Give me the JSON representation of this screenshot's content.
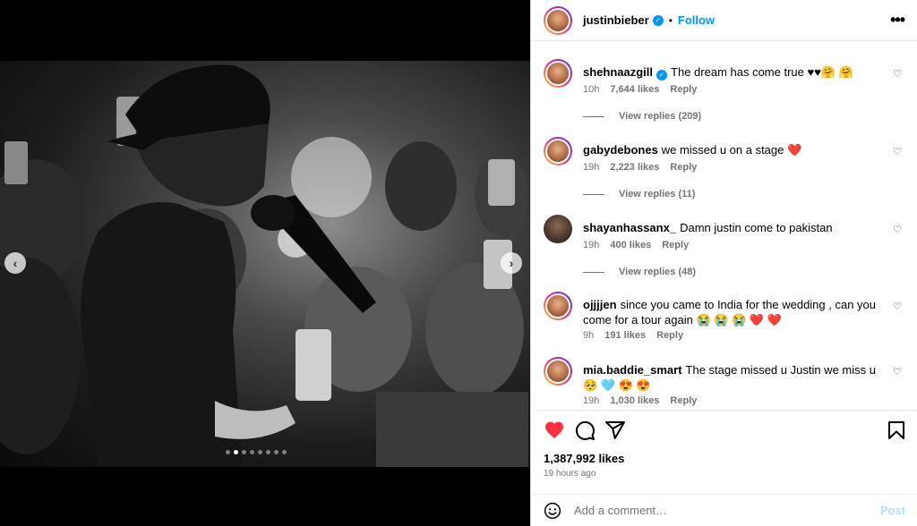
{
  "post": {
    "author": "justinbieber",
    "follow_label": "Follow",
    "separator": "•",
    "more_label": "•••",
    "likes": "1,387,992 likes",
    "time_ago": "19 hours ago"
  },
  "comments": [
    {
      "user": "shehnaazgill",
      "verified": true,
      "text": "The dream has come true ♥♥🤗 🤗",
      "time": "10h",
      "likes": "7,644 likes",
      "reply": "Reply",
      "view_replies": "View replies (209)"
    },
    {
      "user": "gabydebones",
      "verified": false,
      "text": "we missed u on a stage ❤️",
      "time": "19h",
      "likes": "2,223 likes",
      "reply": "Reply",
      "view_replies": "View replies (11)"
    },
    {
      "user": "shayanhassanx_",
      "verified": false,
      "text": "Damn justin come to pakistan",
      "time": "19h",
      "likes": "400 likes",
      "reply": "Reply",
      "view_replies": "View replies (48)"
    },
    {
      "user": "ojjjjen",
      "verified": false,
      "text": "since you came to India for the wedding , can you come for a tour again 😭 😭 😭 ❤️ ❤️",
      "time": "9h",
      "likes": "191 likes",
      "reply": "Reply"
    },
    {
      "user": "mia.baddie_smart",
      "verified": false,
      "text": "The stage missed u Justin we miss u 🥺 🩵 😍 😍",
      "time": "19h",
      "likes": "1,030 likes",
      "reply": "Reply"
    }
  ],
  "add_comment": {
    "placeholder": "Add a comment…",
    "post_label": "Post"
  },
  "icons": {
    "like": "heart-filled-icon",
    "comment": "comment-bubble-icon",
    "share": "paper-plane-icon",
    "save": "bookmark-icon",
    "emoji": "smiley-icon",
    "comment_like": "heart-outline-icon",
    "prev": "chevron-left-icon",
    "next": "chevron-right-icon"
  },
  "carousel": {
    "slide_count": 8,
    "active_slide": 1
  },
  "colors": {
    "accent": "#0095f6",
    "like_red": "#ff3040",
    "muted": "#737373"
  }
}
